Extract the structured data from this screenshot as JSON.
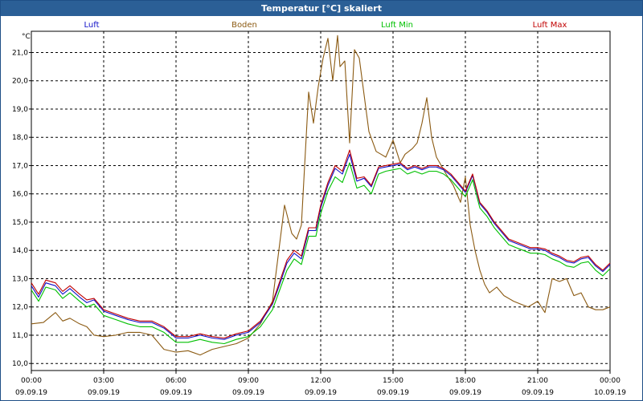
{
  "window": {
    "title": "Temperatur [°C] skaliert"
  },
  "chart_data": {
    "type": "line",
    "title": "Temperatur [°C] skaliert",
    "unit_label": "°C",
    "ylim": [
      9.75,
      21.75
    ],
    "y_ticks": [
      "10,0",
      "11,0",
      "12,0",
      "13,0",
      "14,0",
      "15,0",
      "16,0",
      "17,0",
      "18,0",
      "19,0",
      "20,0",
      "21,0"
    ],
    "y_tick_values": [
      10,
      11,
      12,
      13,
      14,
      15,
      16,
      17,
      18,
      19,
      20,
      21
    ],
    "xlim": [
      0,
      24
    ],
    "x_tick_values": [
      0,
      3,
      6,
      9,
      12,
      15,
      18,
      21,
      24
    ],
    "x_ticks": [
      {
        "time": "00:00",
        "date": "09.09.19"
      },
      {
        "time": "03:00",
        "date": "09.09.19"
      },
      {
        "time": "06:00",
        "date": "09.09.19"
      },
      {
        "time": "09:00",
        "date": "09.09.19"
      },
      {
        "time": "12:00",
        "date": "09.09.19"
      },
      {
        "time": "15:00",
        "date": "09.09.19"
      },
      {
        "time": "18:00",
        "date": "09.09.19"
      },
      {
        "time": "21:00",
        "date": "09.09.19"
      },
      {
        "time": "00:00",
        "date": "10.09.19"
      }
    ],
    "grid": true,
    "legend_position": "top",
    "series": [
      {
        "name": "Boden",
        "color": "#8b5a12",
        "x": [
          0,
          0.5,
          1,
          1.3,
          1.6,
          2,
          2.3,
          2.6,
          3,
          3.5,
          4,
          4.5,
          5,
          5.5,
          6,
          6.5,
          7,
          7.5,
          8,
          8.5,
          9,
          9.5,
          10,
          10.5,
          10.8,
          11,
          11.2,
          11.5,
          11.7,
          11.9,
          12.1,
          12.3,
          12.5,
          12.7,
          12.8,
          13,
          13.2,
          13.4,
          13.6,
          14,
          14.3,
          14.5,
          14.7,
          15,
          15.3,
          15.5,
          15.8,
          16,
          16.2,
          16.4,
          16.6,
          16.8,
          17,
          17.2,
          17.5,
          17.8,
          18,
          18.2,
          18.4,
          18.6,
          18.8,
          19,
          19.3,
          19.6,
          20,
          20.3,
          20.6,
          21,
          21.3,
          21.6,
          21.9,
          22.2,
          22.5,
          22.8,
          23.1,
          23.4,
          23.7,
          24
        ],
        "values": [
          11.4,
          11.45,
          11.8,
          11.5,
          11.6,
          11.4,
          11.3,
          11.0,
          10.95,
          11.0,
          11.1,
          11.1,
          11.0,
          10.5,
          10.4,
          10.45,
          10.3,
          10.5,
          10.6,
          10.7,
          10.9,
          11.4,
          12.2,
          15.6,
          14.6,
          14.4,
          14.9,
          19.6,
          18.5,
          19.8,
          20.8,
          21.5,
          20.0,
          21.6,
          20.5,
          20.7,
          17.8,
          21.1,
          20.8,
          18.2,
          17.5,
          17.4,
          17.3,
          17.9,
          17.1,
          17.4,
          17.6,
          17.8,
          18.5,
          19.4,
          18.0,
          17.3,
          17.0,
          16.7,
          16.3,
          15.7,
          16.6,
          14.9,
          14.0,
          13.3,
          12.8,
          12.5,
          12.7,
          12.4,
          12.2,
          12.1,
          12.0,
          12.2,
          11.8,
          13.0,
          12.9,
          13.0,
          12.4,
          12.5,
          12.0,
          11.9,
          11.9,
          12.0
        ]
      },
      {
        "name": "Luft Min",
        "color": "#00c000",
        "x": [
          0,
          0.3,
          0.6,
          1,
          1.3,
          1.6,
          2,
          2.3,
          2.6,
          3,
          3.5,
          4,
          4.5,
          5,
          5.5,
          6,
          6.5,
          7,
          7.5,
          8,
          8.5,
          9,
          9.5,
          10,
          10.3,
          10.6,
          10.9,
          11.2,
          11.5,
          11.8,
          12,
          12.3,
          12.6,
          12.9,
          13.2,
          13.5,
          13.8,
          14.1,
          14.4,
          14.7,
          15,
          15.3,
          15.6,
          15.9,
          16.2,
          16.5,
          16.8,
          17.1,
          17.4,
          17.7,
          18,
          18.3,
          18.6,
          18.9,
          19.2,
          19.5,
          19.8,
          20.1,
          20.4,
          20.7,
          21,
          21.3,
          21.6,
          21.9,
          22.2,
          22.5,
          22.8,
          23.1,
          23.4,
          23.7,
          24
        ],
        "values": [
          12.6,
          12.2,
          12.7,
          12.6,
          12.3,
          12.5,
          12.2,
          12.0,
          12.1,
          11.7,
          11.55,
          11.4,
          11.3,
          11.3,
          11.1,
          10.75,
          10.75,
          10.85,
          10.75,
          10.7,
          10.85,
          10.95,
          11.3,
          11.9,
          12.6,
          13.3,
          13.7,
          13.5,
          14.5,
          14.5,
          15.3,
          16.1,
          16.6,
          16.4,
          17.1,
          16.2,
          16.3,
          16.0,
          16.7,
          16.8,
          16.85,
          16.9,
          16.7,
          16.8,
          16.7,
          16.8,
          16.8,
          16.7,
          16.5,
          16.2,
          15.9,
          16.5,
          15.5,
          15.2,
          14.8,
          14.5,
          14.2,
          14.1,
          14.0,
          13.9,
          13.9,
          13.85,
          13.7,
          13.6,
          13.45,
          13.4,
          13.55,
          13.6,
          13.3,
          13.1,
          13.35
        ]
      },
      {
        "name": "Luft",
        "color": "#1010c8",
        "x": [
          0,
          0.3,
          0.6,
          1,
          1.3,
          1.6,
          2,
          2.3,
          2.6,
          3,
          3.5,
          4,
          4.5,
          5,
          5.5,
          6,
          6.5,
          7,
          7.5,
          8,
          8.5,
          9,
          9.5,
          10,
          10.3,
          10.6,
          10.9,
          11.2,
          11.5,
          11.8,
          12,
          12.3,
          12.6,
          12.9,
          13.2,
          13.5,
          13.8,
          14.1,
          14.4,
          14.7,
          15,
          15.3,
          15.6,
          15.9,
          16.2,
          16.5,
          16.8,
          17.1,
          17.4,
          17.7,
          18,
          18.3,
          18.6,
          18.9,
          19.2,
          19.5,
          19.8,
          20.1,
          20.4,
          20.7,
          21,
          21.3,
          21.6,
          21.9,
          22.2,
          22.5,
          22.8,
          23.1,
          23.4,
          23.7,
          24
        ],
        "values": [
          12.75,
          12.35,
          12.85,
          12.75,
          12.45,
          12.65,
          12.35,
          12.15,
          12.25,
          11.85,
          11.7,
          11.55,
          11.45,
          11.45,
          11.25,
          10.9,
          10.9,
          11.0,
          10.9,
          10.85,
          11.0,
          11.1,
          11.45,
          12.1,
          12.8,
          13.55,
          13.9,
          13.7,
          14.7,
          14.7,
          15.5,
          16.3,
          16.9,
          16.7,
          17.4,
          16.45,
          16.55,
          16.25,
          16.9,
          16.95,
          17.0,
          17.05,
          16.85,
          16.95,
          16.85,
          16.95,
          16.95,
          16.85,
          16.65,
          16.35,
          16.05,
          16.65,
          15.65,
          15.35,
          14.95,
          14.65,
          14.35,
          14.25,
          14.15,
          14.05,
          14.05,
          14.0,
          13.85,
          13.75,
          13.6,
          13.55,
          13.7,
          13.75,
          13.45,
          13.25,
          13.5
        ]
      },
      {
        "name": "Luft Max",
        "color": "#c00000",
        "x": [
          0,
          0.3,
          0.6,
          1,
          1.3,
          1.6,
          2,
          2.3,
          2.6,
          3,
          3.5,
          4,
          4.5,
          5,
          5.5,
          6,
          6.5,
          7,
          7.5,
          8,
          8.5,
          9,
          9.5,
          10,
          10.3,
          10.6,
          10.9,
          11.2,
          11.5,
          11.8,
          12,
          12.3,
          12.6,
          12.9,
          13.2,
          13.5,
          13.8,
          14.1,
          14.4,
          14.7,
          15,
          15.3,
          15.6,
          15.9,
          16.2,
          16.5,
          16.8,
          17.1,
          17.4,
          17.7,
          18,
          18.3,
          18.6,
          18.9,
          19.2,
          19.5,
          19.8,
          20.1,
          20.4,
          20.7,
          21,
          21.3,
          21.6,
          21.9,
          22.2,
          22.5,
          22.8,
          23.1,
          23.4,
          23.7,
          24
        ],
        "values": [
          12.85,
          12.45,
          12.95,
          12.85,
          12.55,
          12.75,
          12.45,
          12.25,
          12.3,
          11.9,
          11.75,
          11.6,
          11.5,
          11.5,
          11.3,
          10.95,
          10.95,
          11.05,
          10.95,
          10.9,
          11.05,
          11.15,
          11.5,
          12.15,
          12.9,
          13.65,
          14.0,
          13.8,
          14.8,
          14.8,
          15.6,
          16.4,
          17.0,
          16.8,
          17.55,
          16.55,
          16.6,
          16.3,
          16.95,
          17.0,
          17.05,
          17.1,
          16.9,
          17.0,
          16.9,
          17.0,
          17.0,
          16.9,
          16.7,
          16.4,
          16.1,
          16.7,
          15.7,
          15.4,
          15.0,
          14.7,
          14.4,
          14.3,
          14.2,
          14.1,
          14.1,
          14.05,
          13.9,
          13.8,
          13.65,
          13.6,
          13.75,
          13.8,
          13.5,
          13.3,
          13.55
        ]
      }
    ]
  }
}
